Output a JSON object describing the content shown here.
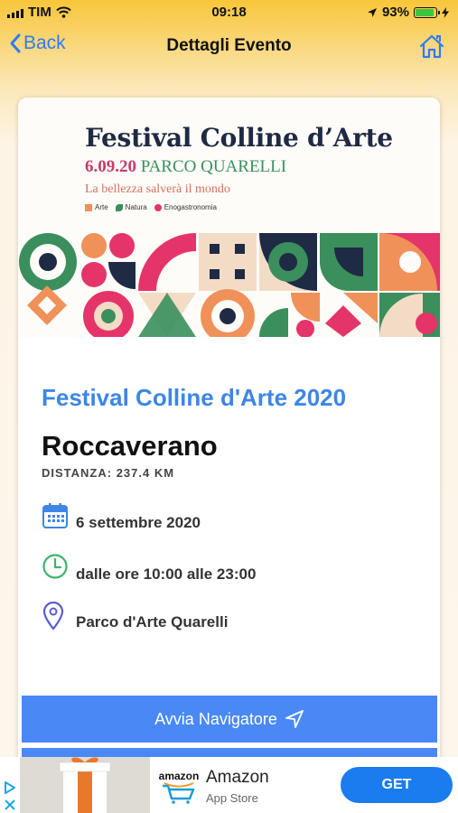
{
  "status_bar": {
    "carrier": "TIM",
    "time": "09:18",
    "battery": "93%",
    "battery_level": 0.93
  },
  "nav": {
    "back_label": "Back",
    "title": "Dettagli Evento"
  },
  "poster": {
    "title": "Festival Colline d’Arte",
    "date": "6.09.20",
    "place": "PARCO QUARELLI",
    "tagline": "La bellezza salverà il mondo",
    "legend": [
      "Arte",
      "Natura",
      "Enogastronomia"
    ],
    "colors": {
      "navy": "#1f2a44",
      "pink": "#e5346a",
      "green": "#3a8f5c",
      "orange": "#f0915a",
      "cream": "#f3dcc6"
    }
  },
  "event": {
    "title": "Festival Colline d'Arte 2020",
    "city": "Roccaverano",
    "distance": "DISTANZA: 237.4 KM",
    "date": "6 settembre 2020",
    "hours": "dalle ore 10:00 alle 23:00",
    "venue": "Parco d'Arte Quarelli"
  },
  "actions": {
    "navigate_label": "Avvia Navigatore"
  },
  "ad": {
    "brand": "amazon",
    "title": "Amazon",
    "subtitle": "App Store",
    "cta": "GET"
  },
  "theme": {
    "accent": "#3d86e6",
    "button": "#4a89f5"
  }
}
